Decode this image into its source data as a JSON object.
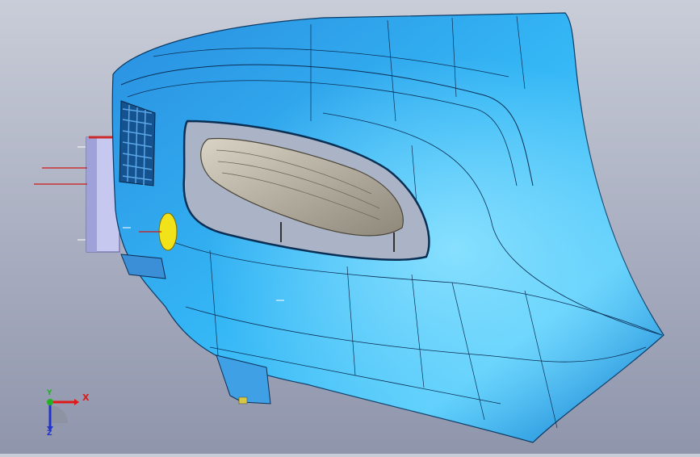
{
  "viewport": {
    "background_top": "#c9cdd8",
    "background_bottom": "#8f95ab",
    "part_color": "#1e9be6",
    "part_highlight": "#6fd0ff",
    "lamp_color": "#b9b3a6",
    "marker_color": "#f2e21a"
  },
  "triad": {
    "x_label": "X",
    "y_label": "Y",
    "z_label": "Z",
    "x_color": "#e01818",
    "y_color": "#22b222",
    "z_color": "#2233cc"
  }
}
